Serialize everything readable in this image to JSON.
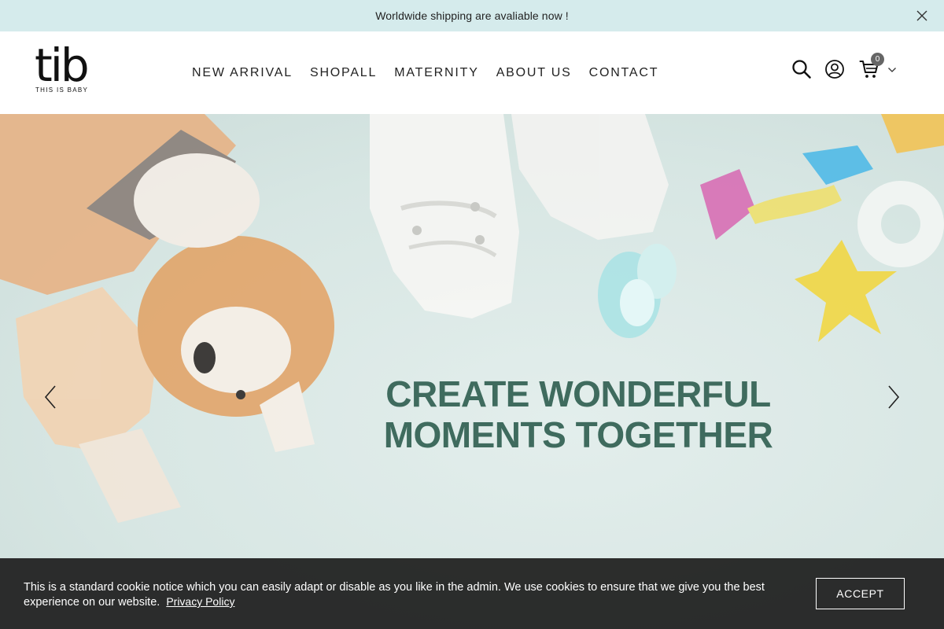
{
  "announcement": {
    "text": "Worldwide shipping are avaliable now !",
    "close_icon": "close-icon"
  },
  "header": {
    "logo": {
      "word": "tib",
      "tagline": "THIS IS BABY"
    },
    "nav": [
      {
        "label": "NEW ARRIVAL"
      },
      {
        "label": "SHOPALL"
      },
      {
        "label": "MATERNITY"
      },
      {
        "label": "ABOUT US"
      },
      {
        "label": "CONTACT"
      }
    ],
    "tools": {
      "search_icon": "search-icon",
      "account_icon": "user-icon",
      "cart_icon": "cart-icon",
      "cart_count": "0",
      "cart_dropdown_icon": "chevron-down-icon"
    }
  },
  "hero": {
    "heading_line1": "CREATE WONDERFUL",
    "heading_line2": "MOMENTS TOGETHER",
    "prev_icon": "chevron-left-icon",
    "next_icon": "chevron-right-icon",
    "heading_color": "#3f6b5e"
  },
  "cookie": {
    "text": "This is a standard cookie notice which you can easily adapt or disable as you like in the admin. We use cookies to ensure that we give you the best experience on our website.",
    "policy_link": "Privacy Policy",
    "accept_label": "ACCEPT"
  },
  "colors": {
    "announcement_bg": "#d5ebec",
    "cookie_bg": "#1c1c1c",
    "cart_badge": "#666666"
  }
}
